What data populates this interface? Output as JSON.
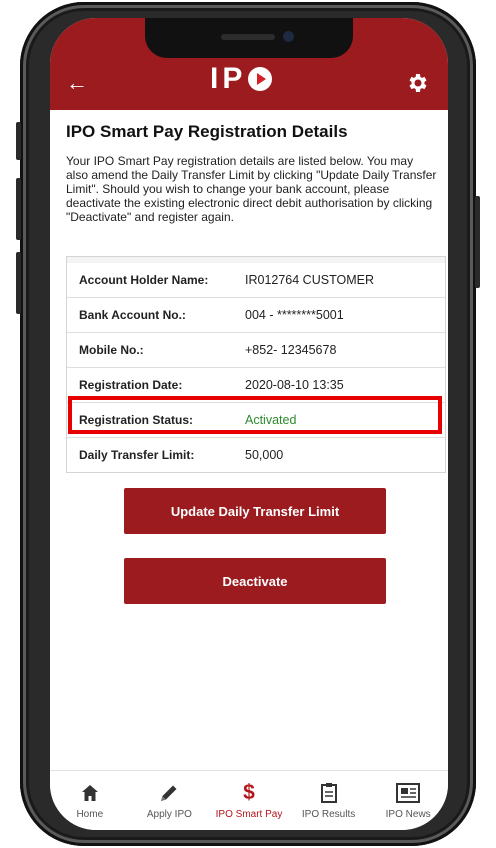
{
  "header": {
    "logo_text": "IP",
    "brand_color": "#9b1b1f"
  },
  "page": {
    "title": "IPO Smart Pay Registration Details",
    "description": "Your IPO Smart Pay registration details are listed below. You may also amend the Daily Transfer Limit by clicking \"Update Daily Transfer Limit\". Should you wish to change your bank account, please deactivate the existing electronic direct debit authorisation by clicking \"Deactivate\" and register again."
  },
  "details": [
    {
      "label": "Account Holder Name:",
      "value": "IR012764 CUSTOMER"
    },
    {
      "label": "Bank Account No.:",
      "value": "004 - ********5001"
    },
    {
      "label": "Mobile No.:",
      "value": "+852- 12345678"
    },
    {
      "label": "Registration Date:",
      "value": "2020-08-10 13:35"
    },
    {
      "label": "Registration Status:",
      "value": "Activated",
      "color": "#2e8b2e"
    },
    {
      "label": "Daily Transfer Limit:",
      "value": "50,000"
    }
  ],
  "buttons": {
    "update_limit": "Update Daily Transfer Limit",
    "deactivate": "Deactivate"
  },
  "nav": [
    {
      "label": "Home",
      "icon": "home-icon"
    },
    {
      "label": "Apply IPO",
      "icon": "pencil-icon"
    },
    {
      "label": "IPO Smart Pay",
      "icon": "dollar-icon",
      "active": true
    },
    {
      "label": "IPO Results",
      "icon": "clipboard-icon"
    },
    {
      "label": "IPO News",
      "icon": "newspaper-icon"
    }
  ]
}
